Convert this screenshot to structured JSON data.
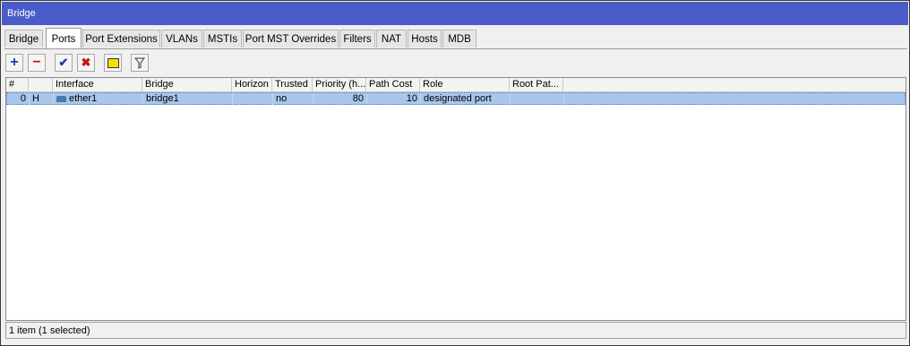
{
  "window": {
    "title": "Bridge"
  },
  "tabs": [
    {
      "label": "Bridge"
    },
    {
      "label": "Ports",
      "active": true
    },
    {
      "label": "Port Extensions"
    },
    {
      "label": "VLANs"
    },
    {
      "label": "MSTIs"
    },
    {
      "label": "Port MST Overrides"
    },
    {
      "label": "Filters"
    },
    {
      "label": "NAT"
    },
    {
      "label": "Hosts"
    },
    {
      "label": "MDB"
    }
  ],
  "toolbar": {
    "buttons": [
      {
        "name": "add-button",
        "icon": "plus-icon",
        "glyph": "+",
        "color": "#1a3fa8"
      },
      {
        "name": "remove-button",
        "icon": "minus-icon",
        "glyph": "−",
        "color": "#c01818"
      },
      {
        "name": "enable-button",
        "icon": "checkmark-icon",
        "glyph": "✔",
        "color": "#1a3fa8"
      },
      {
        "name": "disable-button",
        "icon": "x-icon",
        "glyph": "✖",
        "color": "#c01818"
      },
      {
        "name": "comment-button",
        "icon": "comment-icon",
        "glyph": "",
        "color": "#f4e000"
      },
      {
        "name": "filter-button",
        "icon": "filter-icon",
        "glyph": "▽",
        "color": "#333333"
      }
    ]
  },
  "table": {
    "columns": [
      "#",
      "",
      "Interface",
      "Bridge",
      "Horizon",
      "Trusted",
      "Priority (h...",
      "Path Cost",
      "Role",
      "Root Pat..."
    ],
    "rows": [
      {
        "index": "0",
        "flag": "H",
        "interface": "ether1",
        "bridge": "bridge1",
        "horizon": "",
        "trusted": "no",
        "priority": "80",
        "path_cost": "10",
        "role": "designated port",
        "root_path": "",
        "selected": true
      }
    ]
  },
  "status": {
    "text": "1 item (1 selected)"
  },
  "colors": {
    "titlebar": "#4a5cc8",
    "selection": "#a7c7ee"
  }
}
